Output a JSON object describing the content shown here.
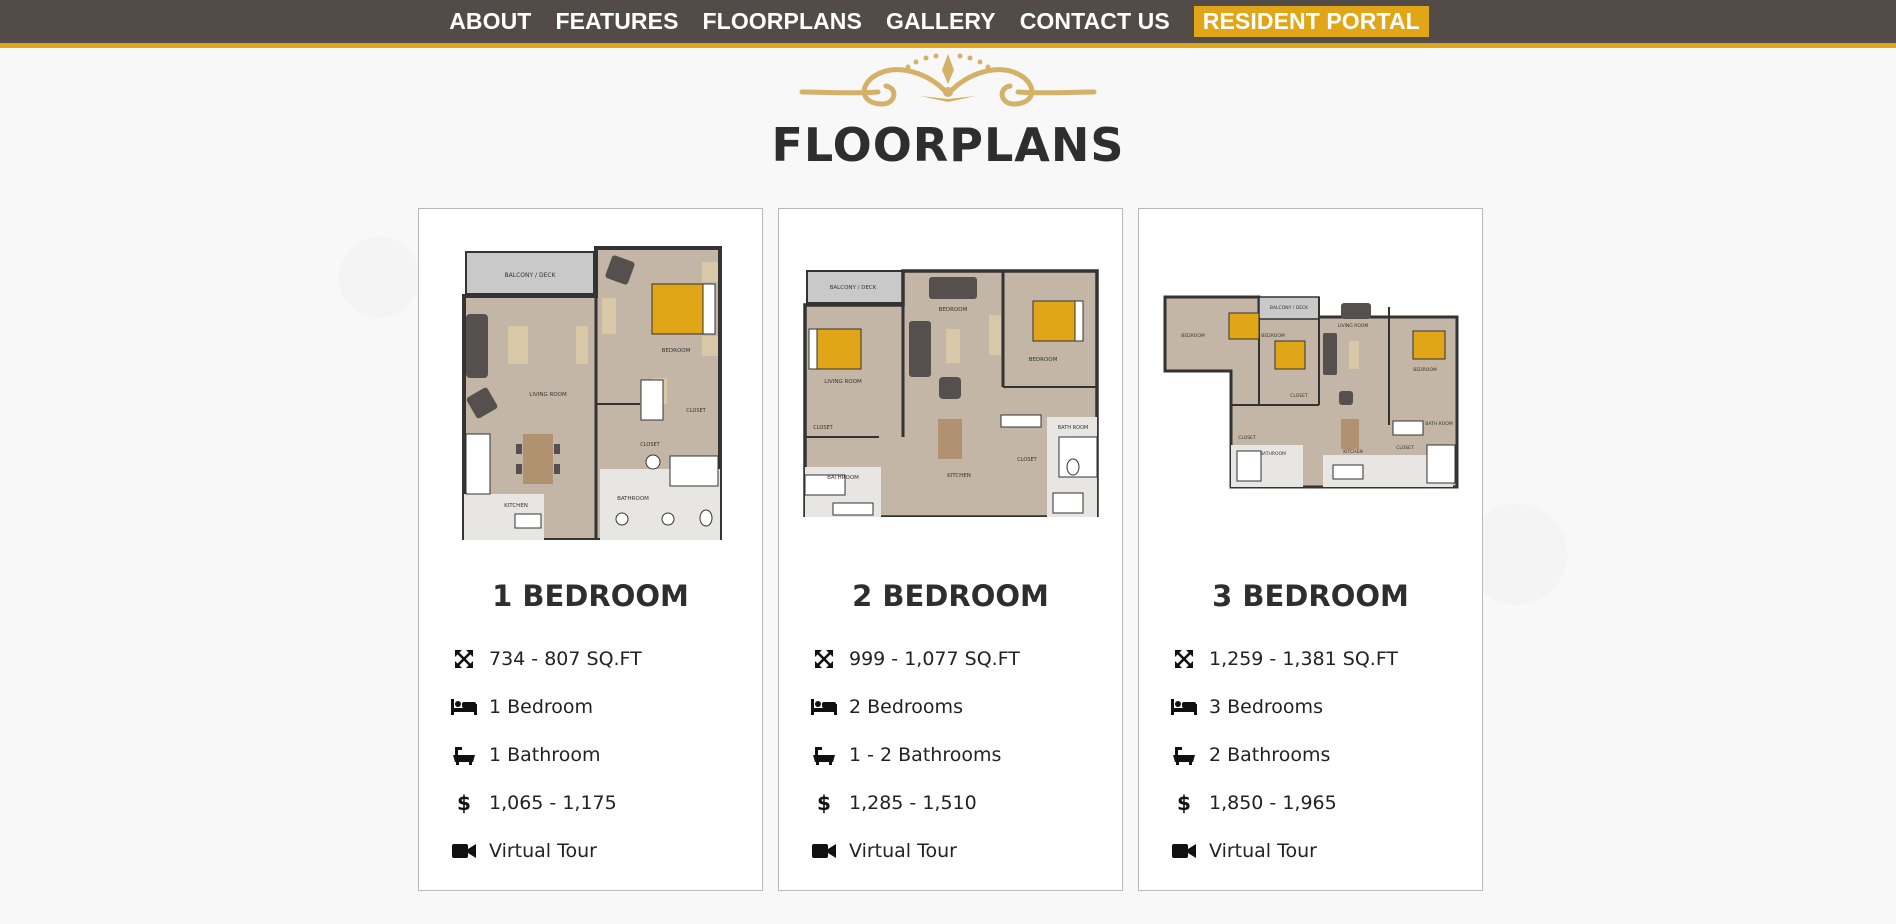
{
  "nav": {
    "items": [
      "ABOUT",
      "FEATURES",
      "FLOORPLANS",
      "GALLERY",
      "CONTACT US"
    ],
    "portal_label": "RESIDENT PORTAL"
  },
  "page_title": "FLOORPLANS",
  "colors": {
    "nav_bg": "#524b47",
    "accent_gold": "#e0a617",
    "ornament_gold": "#d4b169",
    "floor_tan": "#c4b6a6",
    "bed_gold": "#e0a617",
    "furniture_dark": "#55504d"
  },
  "plans": [
    {
      "title": "1 BEDROOM",
      "sqft": "734 - 807 SQ.FT",
      "bedrooms": "1 Bedroom",
      "bathrooms": "1 Bathroom",
      "price": "1,065 - 1,175",
      "tour": "Virtual Tour",
      "room_labels": [
        "BALCONY / DECK",
        "BEDROOM",
        "LIVING ROOM",
        "CLOSET",
        "CLOSET",
        "KITCHEN",
        "BATHROOM"
      ]
    },
    {
      "title": "2 BEDROOM",
      "sqft": "999 - 1,077 SQ.FT",
      "bedrooms": "2 Bedrooms",
      "bathrooms": "1 - 2 Bathrooms",
      "price": "1,285 - 1,510",
      "tour": "Virtual Tour",
      "room_labels": [
        "BALCONY / DECK",
        "LIVING ROOM",
        "BEDROOM",
        "BEDROOM",
        "CLOSET",
        "CLOSET",
        "KITCHEN",
        "BATHROOM",
        "BATH ROOM"
      ]
    },
    {
      "title": "3 BEDROOM",
      "sqft": "1,259 - 1,381 SQ.FT",
      "bedrooms": "3 Bedrooms",
      "bathrooms": "2 Bathrooms",
      "price": "1,850 - 1,965",
      "tour": "Virtual Tour",
      "room_labels": [
        "BALCONY / DECK",
        "BEDROOM",
        "BEDROOM",
        "LIVING ROOM",
        "BEDROOM",
        "CLOSET",
        "CLOSET",
        "CLOSET",
        "BATHROOM",
        "KITCHEN",
        "BATH ROOM"
      ]
    }
  ],
  "icons": {
    "sqft": "expand-arrows-icon",
    "bedrooms": "bed-icon",
    "bathrooms": "bathtub-icon",
    "price": "dollar-icon",
    "tour": "video-camera-icon"
  }
}
